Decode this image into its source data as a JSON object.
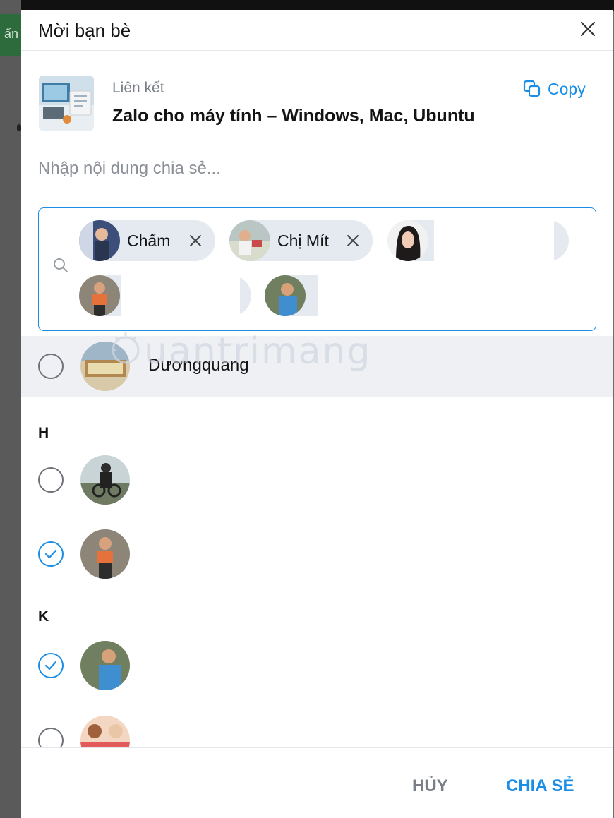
{
  "background_app": {
    "partial_text": "ấn"
  },
  "dialog": {
    "title": "Mời bạn bè",
    "close_icon": "close-icon"
  },
  "link": {
    "caption": "Liên kết",
    "title": "Zalo cho máy tính – Windows, Mac, Ubuntu",
    "copy_label": "Copy",
    "copy_icon": "copy-icon"
  },
  "share_input": {
    "placeholder": "Nhập nội dung chia sẻ...",
    "value": ""
  },
  "selected_chips": [
    {
      "name": "Chấm",
      "removable": true
    },
    {
      "name": "Chị Mít",
      "removable": true
    },
    {
      "name": "",
      "removable": false
    },
    {
      "name": "",
      "removable": false
    },
    {
      "name": "",
      "removable": false
    }
  ],
  "contacts": [
    {
      "name": "Dươngquang",
      "checked": false,
      "highlighted": true
    },
    {
      "section": "H"
    },
    {
      "name": "",
      "checked": false
    },
    {
      "name": "",
      "checked": true
    },
    {
      "section": "K"
    },
    {
      "name": "",
      "checked": true
    },
    {
      "name": "",
      "checked": false
    }
  ],
  "watermark": "uantrimang",
  "footer": {
    "cancel_label": "HỦY",
    "share_label": "CHIA SẺ"
  },
  "colors": {
    "accent": "#1a8ee6",
    "muted": "#7a7f87",
    "highlight_row": "#eef0f3",
    "chip_bg": "#e5e9f0"
  }
}
